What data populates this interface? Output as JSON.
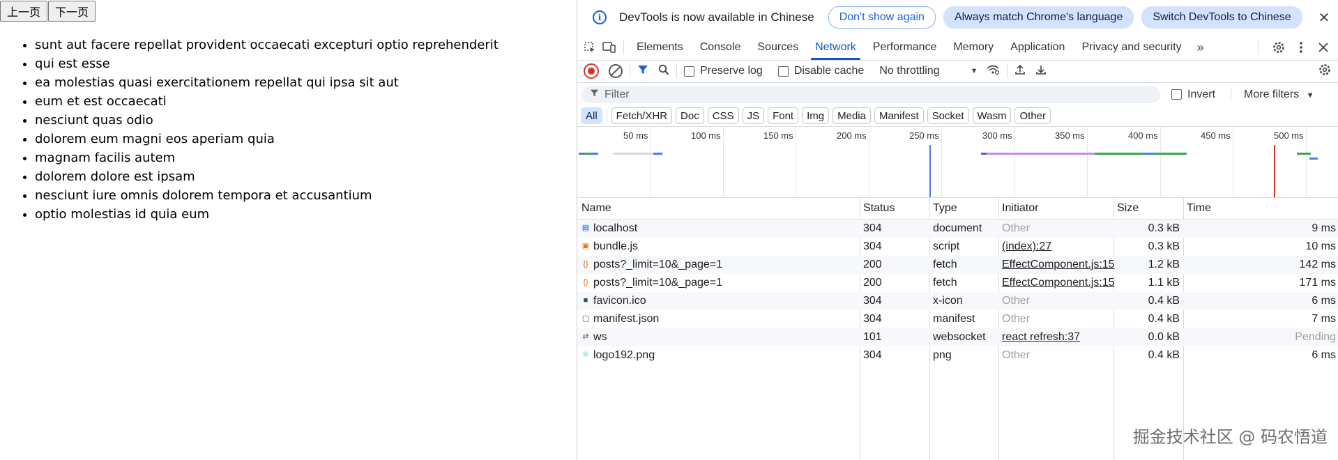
{
  "pager": {
    "prev_label": "上一页",
    "next_label": "下一页"
  },
  "posts": [
    "sunt aut facere repellat provident occaecati excepturi optio reprehenderit",
    "qui est esse",
    "ea molestias quasi exercitationem repellat qui ipsa sit aut",
    "eum et est occaecati",
    "nesciunt quas odio",
    "dolorem eum magni eos aperiam quia",
    "magnam facilis autem",
    "dolorem dolore est ipsam",
    "nesciunt iure omnis dolorem tempora et accusantium",
    "optio molestias id quia eum"
  ],
  "infobar": {
    "message": "DevTools is now available in Chinese",
    "dont_show": "Don't show again",
    "always_match": "Always match Chrome's language",
    "switch": "Switch DevTools to Chinese",
    "close_glyph": "✕"
  },
  "tabs": [
    "Elements",
    "Console",
    "Sources",
    "Network",
    "Performance",
    "Memory",
    "Application",
    "Privacy and security"
  ],
  "active_tab": "Network",
  "toolbar": {
    "preserve_log": "Preserve log",
    "disable_cache": "Disable cache",
    "throttling": "No throttling"
  },
  "filter": {
    "placeholder": "Filter",
    "invert": "Invert",
    "more_filters": "More filters"
  },
  "type_filters": [
    "All",
    "Fetch/XHR",
    "Doc",
    "CSS",
    "JS",
    "Font",
    "Img",
    "Media",
    "Manifest",
    "Socket",
    "Wasm",
    "Other"
  ],
  "active_type": "All",
  "overview_ticks": [
    "50 ms",
    "100 ms",
    "150 ms",
    "200 ms",
    "250 ms",
    "300 ms",
    "350 ms",
    "400 ms",
    "450 ms",
    "500 ms"
  ],
  "columns": {
    "name": "Name",
    "status": "Status",
    "type": "Type",
    "initiator": "Initiator",
    "size": "Size",
    "time": "Time"
  },
  "requests": [
    {
      "icon": "document-icon",
      "name": "localhost",
      "status": "304",
      "type": "document",
      "initiator": "Other",
      "initiator_link": false,
      "size": "0.3 kB",
      "time": "9 ms"
    },
    {
      "icon": "script-icon",
      "name": "bundle.js",
      "status": "304",
      "type": "script",
      "initiator": "(index):27",
      "initiator_link": true,
      "size": "0.3 kB",
      "time": "10 ms"
    },
    {
      "icon": "fetch-icon",
      "name": "posts?_limit=10&_page=1",
      "status": "200",
      "type": "fetch",
      "initiator": "EffectComponent.js:15",
      "initiator_link": true,
      "size": "1.2 kB",
      "time": "142 ms"
    },
    {
      "icon": "fetch-icon",
      "name": "posts?_limit=10&_page=1",
      "status": "200",
      "type": "fetch",
      "initiator": "EffectComponent.js:15",
      "initiator_link": true,
      "size": "1.1 kB",
      "time": "171 ms"
    },
    {
      "icon": "favicon-icon",
      "name": "favicon.ico",
      "status": "304",
      "type": "x-icon",
      "initiator": "Other",
      "initiator_link": false,
      "size": "0.4 kB",
      "time": "6 ms"
    },
    {
      "icon": "manifest-icon",
      "name": "manifest.json",
      "status": "304",
      "type": "manifest",
      "initiator": "Other",
      "initiator_link": false,
      "size": "0.4 kB",
      "time": "7 ms"
    },
    {
      "icon": "websocket-icon",
      "name": "ws",
      "status": "101",
      "type": "websocket",
      "initiator": "react refresh:37",
      "initiator_link": true,
      "size": "0.0 kB",
      "time": "Pending"
    },
    {
      "icon": "image-icon",
      "name": "logo192.png",
      "status": "304",
      "type": "png",
      "initiator": "Other",
      "initiator_link": false,
      "size": "0.4 kB",
      "time": "6 ms"
    }
  ],
  "watermark": "掘金技术社区 @ 码农悟道",
  "colors": {
    "accent": "#0b57d0",
    "record": "#d93025",
    "chip_active": "#d3e3fd"
  }
}
